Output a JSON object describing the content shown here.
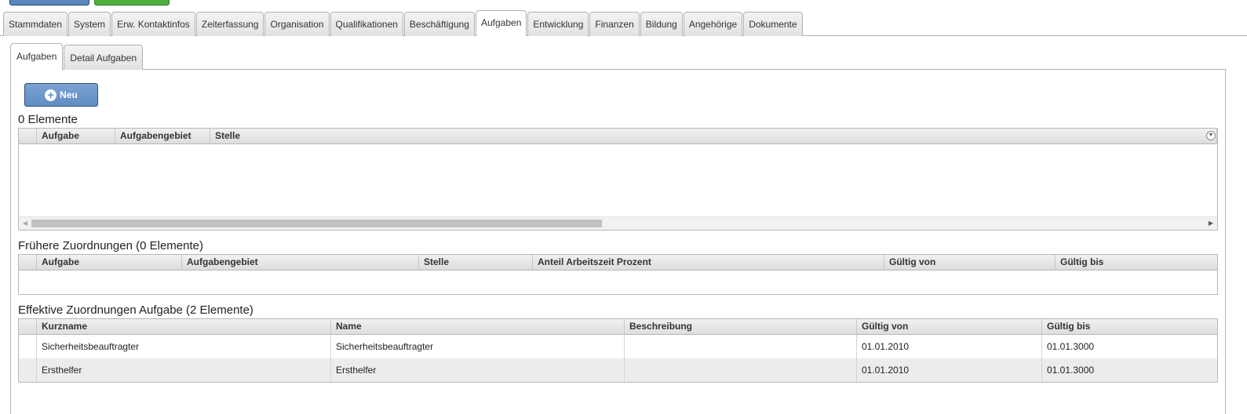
{
  "main_tabs": [
    {
      "label": "Stammdaten"
    },
    {
      "label": "System"
    },
    {
      "label": "Erw. Kontaktinfos"
    },
    {
      "label": "Zeiterfassung"
    },
    {
      "label": "Organisation"
    },
    {
      "label": "Qualifikationen"
    },
    {
      "label": "Beschäftigung"
    },
    {
      "label": "Aufgaben"
    },
    {
      "label": "Entwicklung"
    },
    {
      "label": "Finanzen"
    },
    {
      "label": "Bildung"
    },
    {
      "label": "Angehörige"
    },
    {
      "label": "Dokumente"
    }
  ],
  "main_tabs_active": "Aufgaben",
  "sub_tabs": [
    {
      "label": "Aufgaben"
    },
    {
      "label": "Detail Aufgaben"
    }
  ],
  "sub_tabs_active": "Aufgaben",
  "new_button": {
    "label": "Neu",
    "icon": "plus-circle-icon"
  },
  "grid_current": {
    "title": "0 Elemente",
    "columns": [
      "Aufgabe",
      "Aufgabengebiet",
      "Stelle"
    ],
    "rows": []
  },
  "grid_former": {
    "title": "Frühere Zuordnungen (0 Elemente)",
    "columns": [
      "Aufgabe",
      "Aufgabengebiet",
      "Stelle",
      "Anteil Arbeitszeit Prozent",
      "Gültig von",
      "Gültig bis"
    ],
    "rows": []
  },
  "grid_effective": {
    "title": "Effektive Zuordnungen Aufgabe (2 Elemente)",
    "columns": [
      "Kurzname",
      "Name",
      "Beschreibung",
      "Gültig von",
      "Gültig bis"
    ],
    "rows": [
      [
        "Sicherheitsbeauftragter",
        "Sicherheitsbeauftragter",
        "",
        "01.01.2010",
        "01.01.3000"
      ],
      [
        "Ersthelfer",
        "Ersthelfer",
        "",
        "01.01.2010",
        "01.01.3000"
      ]
    ]
  },
  "colors": {
    "accent": "#5f8dc4",
    "secondary_top_button": "#4caf3c"
  }
}
